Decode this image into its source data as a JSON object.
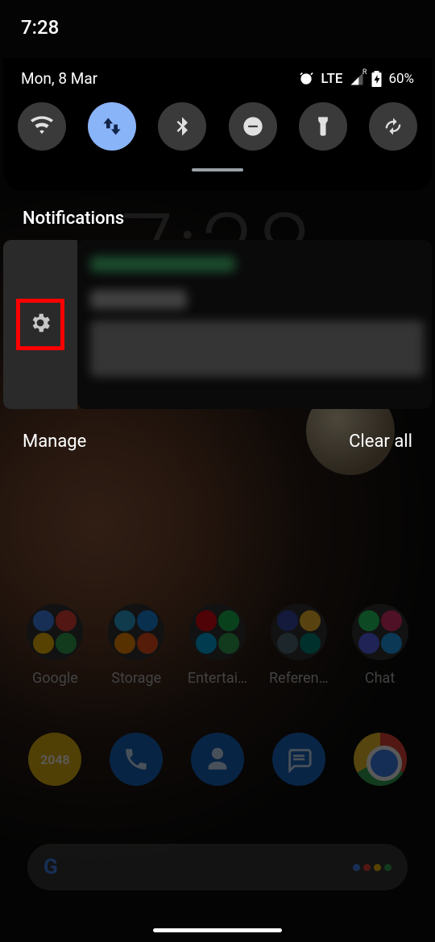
{
  "status_bar": {
    "time": "7:28"
  },
  "shade": {
    "date": "Mon, 8 Mar",
    "status": {
      "alarm_set": true,
      "network": "LTE",
      "roaming_badge": "R",
      "battery": "60%"
    },
    "tiles": [
      {
        "name": "wifi",
        "active": false
      },
      {
        "name": "data",
        "active": true
      },
      {
        "name": "bluetooth",
        "active": false
      },
      {
        "name": "dnd",
        "active": false
      },
      {
        "name": "flashlight",
        "active": false
      },
      {
        "name": "rotate",
        "active": false
      }
    ]
  },
  "notifications": {
    "header": "Notifications",
    "swipe_action": "settings",
    "manage_label": "Manage",
    "clear_label": "Clear all"
  },
  "home": {
    "bg_clock": "7:28",
    "folders": [
      {
        "label": "Google",
        "icons": [
          "#4285f4",
          "#ea4335",
          "#fbbc05",
          "#34a853"
        ]
      },
      {
        "label": "Storage",
        "icons": [
          "#2aa8d8",
          "#1e88e5",
          "#fb8c00",
          "#f4511e"
        ]
      },
      {
        "label": "Entertai…",
        "icons": [
          "#e50914",
          "#1db954",
          "#00a8e1",
          "#34a853"
        ]
      },
      {
        "label": "Referen…",
        "icons": [
          "#3949ab",
          "#fbc02d",
          "#546e7a",
          "#00897b"
        ]
      },
      {
        "label": "Chat",
        "icons": [
          "#25d366",
          "#e1306c",
          "#5865f2",
          "#1da1f2"
        ]
      }
    ],
    "dock": [
      {
        "name": "2048",
        "kind": "game",
        "text": "2048"
      },
      {
        "name": "Phone",
        "kind": "phone"
      },
      {
        "name": "Contacts",
        "kind": "contact"
      },
      {
        "name": "Messages",
        "kind": "msg"
      },
      {
        "name": "Chrome",
        "kind": "chrome"
      }
    ],
    "search_placeholder": "",
    "assistant_colors": [
      "#4285f4",
      "#ea4335",
      "#fbbc05",
      "#34a853"
    ]
  }
}
